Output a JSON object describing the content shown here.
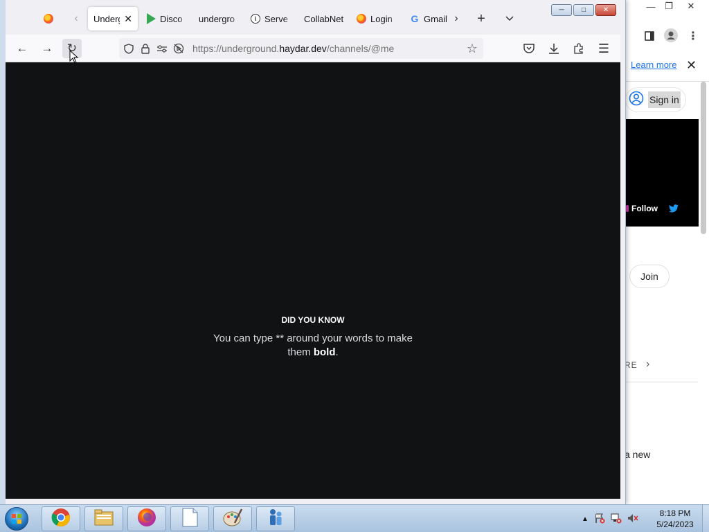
{
  "background_window": {
    "learn_more": "Learn more",
    "sign_in": "Sign in",
    "follow": "Follow",
    "join": "Join",
    "more_label": "RE",
    "a_new": "a new"
  },
  "firefox": {
    "tabs": [
      {
        "label": "Underg",
        "favicon": "firefox-icon",
        "active": true
      },
      {
        "label": "Disco",
        "favicon": "play-store-icon"
      },
      {
        "label": "undergro",
        "favicon": "none"
      },
      {
        "label": "Serve",
        "favicon": "info-icon"
      },
      {
        "label": "CollabNet",
        "favicon": "none"
      },
      {
        "label": "Login",
        "favicon": "firefox-icon"
      },
      {
        "label": "Gmail",
        "favicon": "google-icon"
      }
    ],
    "url": {
      "prefix": "https://underground.",
      "host": "haydar.dev",
      "path": "/channels/@me"
    }
  },
  "page": {
    "tip_heading": "DID YOU KNOW",
    "tip_text_1": "You can type ** around your words to make them ",
    "tip_bold": "bold",
    "tip_end": "."
  },
  "taskbar": {
    "apps": [
      "chrome-icon",
      "file-explorer-icon",
      "firefox-icon",
      "notepad-icon",
      "paint-icon",
      "network-icon"
    ],
    "clock_time": "8:18 PM",
    "clock_date": "5/24/2023"
  },
  "colors": {
    "content_bg": "#101214",
    "tab_bar": "#f0f0f4",
    "taskbar": "#b7cde5"
  }
}
